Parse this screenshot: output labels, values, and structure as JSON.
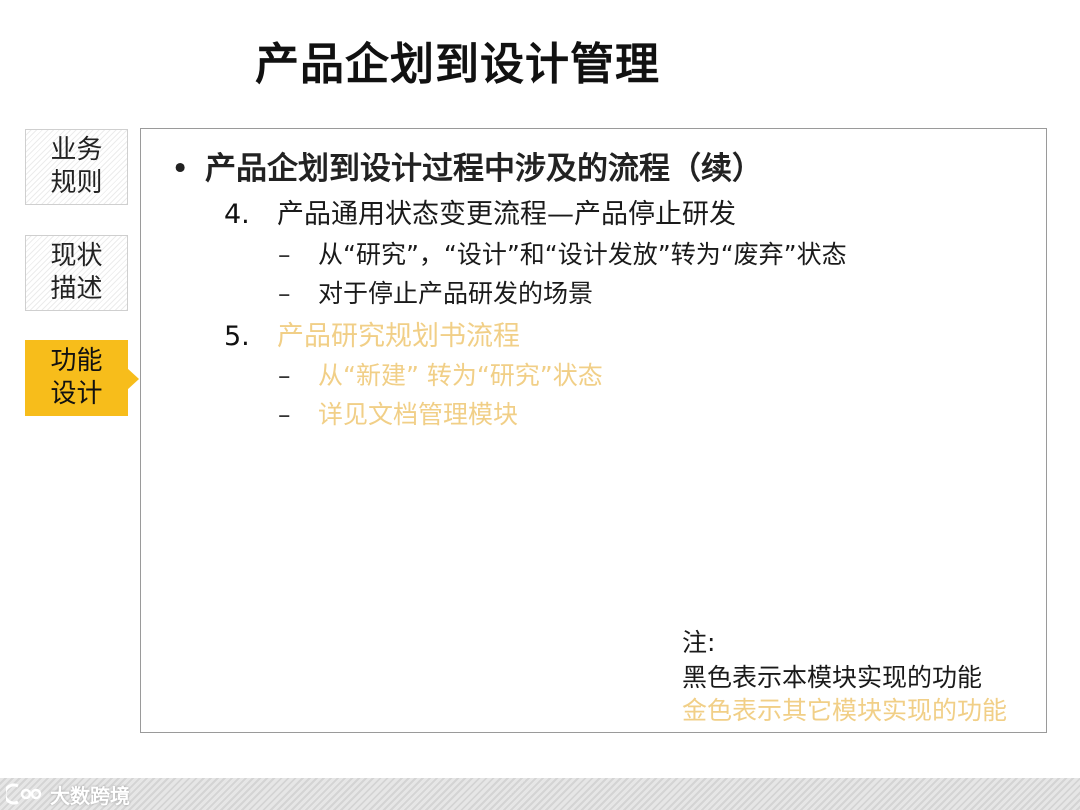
{
  "title": "产品企划到设计管理",
  "sidebar": {
    "tabs": [
      {
        "label": "业务\n规则",
        "active": false
      },
      {
        "label": "现状\n描述",
        "active": false
      },
      {
        "label": "功能\n设计",
        "active": true
      }
    ]
  },
  "content": {
    "bullet_symbol": "•",
    "heading": "产品企划到设计过程中涉及的流程（续）",
    "items": [
      {
        "number": "4.",
        "text": "产品通用状态变更流程—产品停止研发",
        "color": "black",
        "subitems": [
          "从“研究”，“设计”和“设计发放”转为“废弃”状态",
          "对于停止产品研发的场景"
        ]
      },
      {
        "number": "5.",
        "text": "产品研究规划书流程",
        "color": "gold",
        "subitems": [
          "从“新建” 转为“研究”状态",
          "详见文档管理模块"
        ]
      }
    ],
    "sub_marker": "–",
    "note": {
      "label": "注:",
      "line_black": "黑色表示本模块实现的功能",
      "line_gold": "金色表示其它模块实现的功能"
    }
  },
  "watermark": {
    "text": "大数跨境"
  },
  "colors": {
    "accent_gold_tab": "#f7bd1b",
    "gold_text": "#f1cf87",
    "box_border": "#9a9a9a"
  }
}
